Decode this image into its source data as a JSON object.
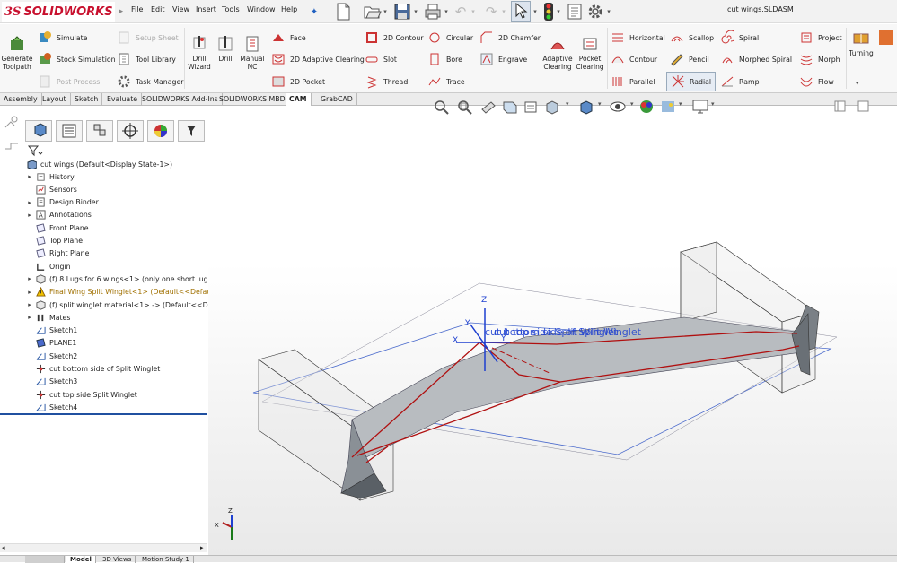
{
  "app": {
    "logo_ds": "3S",
    "logo_text": "SOLIDWORKS",
    "document_title": "cut wings.SLDASM"
  },
  "menu": [
    "File",
    "Edit",
    "View",
    "Insert",
    "Tools",
    "Window",
    "Help"
  ],
  "ribbon": {
    "cam_left": [
      {
        "label": "Generate\nToolpath",
        "icon": "generate-toolpath-icon"
      },
      {
        "label": "Simulate",
        "icon": "simulate-icon"
      },
      {
        "label": "Stock Simulation",
        "icon": "stock-simulation-icon"
      },
      {
        "label": "Post Process",
        "icon": "post-process-icon",
        "disabled": true
      },
      {
        "label": "Setup Sheet",
        "icon": "setup-sheet-icon",
        "disabled": true
      },
      {
        "label": "Tool Library",
        "icon": "tool-library-icon"
      },
      {
        "label": "Task Manager",
        "icon": "task-manager-icon"
      },
      {
        "label": "Drill\nWizard",
        "icon": "drill-wizard-icon"
      },
      {
        "label": "Drill",
        "icon": "drill-icon"
      },
      {
        "label": "Manual\nNC",
        "icon": "manual-nc-icon"
      }
    ],
    "ops2d": [
      "Face",
      "2D Adaptive Clearing",
      "2D Pocket",
      "2D Contour",
      "Slot",
      "Thread",
      "Circular",
      "Bore",
      "Trace",
      "2D Chamfer",
      "Engrave"
    ],
    "ops3d_left": [
      "Adaptive\nClearing",
      "Pocket\nClearing"
    ],
    "ops3d": [
      "Horizontal",
      "Contour",
      "Parallel",
      "Scallop",
      "Pencil",
      "Radial",
      "Spiral",
      "Morphed Spiral",
      "Ramp",
      "Project",
      "Morph",
      "Flow"
    ],
    "turning": "Turning"
  },
  "tabs": [
    "Assembly",
    "Layout",
    "Sketch",
    "Evaluate",
    "SOLIDWORKS Add-Ins",
    "SOLIDWORKS MBD",
    "CAM",
    "GrabCAD"
  ],
  "active_tab": "CAM",
  "tree": {
    "root": "cut wings  (Default<Display State-1>)",
    "items": [
      {
        "label": "History",
        "icon": "history-icon",
        "expand": true
      },
      {
        "label": "Sensors",
        "icon": "sensors-icon",
        "expand": false
      },
      {
        "label": "Design Binder",
        "icon": "design-binder-icon",
        "expand": true
      },
      {
        "label": "Annotations",
        "icon": "annotations-icon",
        "expand": true
      },
      {
        "label": "Front Plane",
        "icon": "plane-icon",
        "expand": false
      },
      {
        "label": "Top Plane",
        "icon": "plane-icon",
        "expand": false
      },
      {
        "label": "Right Plane",
        "icon": "plane-icon",
        "expand": false
      },
      {
        "label": "Origin",
        "icon": "origin-icon",
        "expand": false
      },
      {
        "label": "(f) 8 Lugs for 6 wings<1> (only one short lug<",
        "icon": "part-icon",
        "expand": true
      },
      {
        "label": "Final Wing Split Winglet<1> (Default<<Defau",
        "icon": "warning-icon",
        "expand": true,
        "warn": true
      },
      {
        "label": "(f) split winglet material<1> -> (Default<<Def",
        "icon": "part-icon",
        "expand": true
      },
      {
        "label": "Mates",
        "icon": "mates-icon",
        "expand": true
      },
      {
        "label": "Sketch1",
        "icon": "sketch-icon",
        "expand": false
      },
      {
        "label": "PLANE1",
        "icon": "plane1-icon",
        "expand": false
      },
      {
        "label": "Sketch2",
        "icon": "sketch-icon",
        "expand": false
      },
      {
        "label": "cut bottom side of Split Winglet",
        "icon": "cut-icon",
        "expand": false
      },
      {
        "label": "Sketch3",
        "icon": "sketch-icon",
        "expand": false
      },
      {
        "label": "cut top side Split Winglet",
        "icon": "cut-icon",
        "expand": false
      },
      {
        "label": "Sketch4",
        "icon": "sketch-icon",
        "expand": false
      }
    ]
  },
  "viewport": {
    "labels": [
      "cut bottom side of Split Winglet",
      "cut top side Split Winglet"
    ],
    "axes": {
      "x": "X",
      "y": "Y",
      "z": "Z"
    }
  },
  "bottom_tabs": [
    "Model",
    "3D Views",
    "Motion Study 1"
  ],
  "colors": {
    "brand": "#c8102e",
    "toolpath": "#b01010",
    "axis": "#1d3fd0",
    "part": "#9aa0a6"
  }
}
